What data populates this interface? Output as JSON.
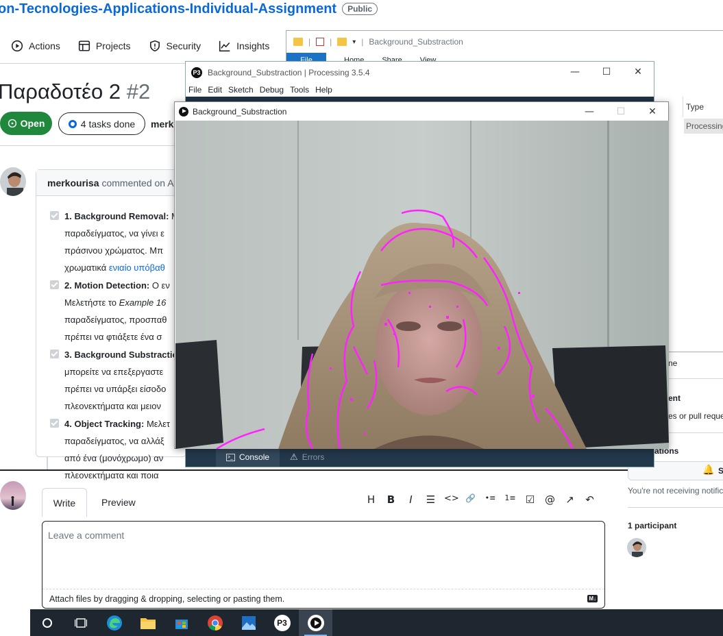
{
  "repo": {
    "name": "on-Tecnologies-Applications-Individual-Assignment",
    "visibility": "Public"
  },
  "repo_tabs": [
    "Actions",
    "Projects",
    "Security",
    "Insights"
  ],
  "issue": {
    "title": "Παραδοτέο 2",
    "number": "#2",
    "state": "Open",
    "tasks": "4 tasks done",
    "author_short": "merk"
  },
  "comment": {
    "author": "merkourisa",
    "meta": "commented on Au",
    "tasks": [
      {
        "title": "1. Background Removal:",
        "lines": [
          " Μ",
          "παραδείγματος, να γίνει ε",
          "πράσινου χρώματος. Μπ",
          "χρωματικά "
        ],
        "link": "ενιαίο υπόβαθ"
      },
      {
        "title": "2. Motion Detection:",
        "lines": [
          " Ο εν",
          "Μελετήστε το ",
          "παραδείγματος, προσπαθ",
          "πρέπει να φτιάξετε ένα σ"
        ],
        "italic": "Example 16"
      },
      {
        "title": "3. Background Substractio",
        "lines": [
          "",
          "μπορείτε να επεξεργαστε",
          "πρέπει να υπάρξει είσοδο",
          "πλεονεκτήματα και μειον"
        ]
      },
      {
        "title": "4. Object Tracking:",
        "lines": [
          " Μελετ",
          "παραδείγματος, να αλλάξ",
          "από ένα (μονόχρωμο) αν",
          "πλεονεκτήματα και ποια "
        ]
      }
    ]
  },
  "editor": {
    "write_tab": "Write",
    "preview_tab": "Preview",
    "placeholder": "Leave a comment",
    "attach_hint": "Attach files by dragging & dropping, selecting or pasting them.",
    "markdown_badge": "M↓",
    "toolbar": [
      "H",
      "B",
      "I",
      "☰",
      "<>",
      "🔗",
      "•≡",
      "1≡",
      "☑",
      "@",
      "↗",
      "↶"
    ]
  },
  "sidebar": {
    "frag1": "ne",
    "frag2": "ent",
    "frag3": "es or pull reque",
    "frag4": "ations",
    "subscribe_frag": "S",
    "not_receiving": "You're not receiving notific",
    "participants": "1 participant"
  },
  "explorer": {
    "title": "Background_Substraction",
    "ribbon": [
      "File",
      "Home",
      "Share",
      "View"
    ],
    "col_type": "Type",
    "row_type": "Processing"
  },
  "ide": {
    "title": "Background_Substraction | Processing 3.5.4",
    "menu": [
      "File",
      "Edit",
      "Sketch",
      "Debug",
      "Tools",
      "Help"
    ],
    "console_tab": "Console",
    "errors_tab": "Errors"
  },
  "sketch": {
    "title": "Background_Substraction"
  },
  "taskbar": [
    "start",
    "task-view",
    "edge",
    "file-explorer",
    "store",
    "chrome",
    "photos",
    "processing",
    "processing-sketch"
  ]
}
